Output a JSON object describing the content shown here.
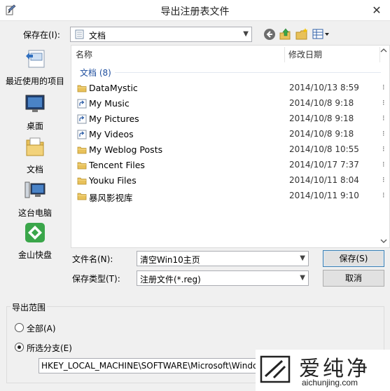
{
  "window": {
    "title": "导出注册表文件",
    "close_glyph": "✕"
  },
  "toolbar": {
    "save_in_label": "保存在(I):",
    "current_location": "文档"
  },
  "places": [
    {
      "label": "最近使用的项目",
      "icon": "recent-items-icon"
    },
    {
      "label": "桌面",
      "icon": "desktop-icon"
    },
    {
      "label": "文档",
      "icon": "documents-icon"
    },
    {
      "label": "这台电脑",
      "icon": "this-pc-icon"
    },
    {
      "label": "金山快盘",
      "icon": "kuaipan-icon"
    }
  ],
  "file_list": {
    "columns": [
      "名称",
      "修改日期"
    ],
    "group_label": "文档 (8)",
    "rows": [
      {
        "name": "DataMystic",
        "date": "2014/10/13 8:59",
        "type": "folder"
      },
      {
        "name": "My Music",
        "date": "2014/10/8 9:18",
        "type": "shortcut"
      },
      {
        "name": "My Pictures",
        "date": "2014/10/8 9:18",
        "type": "shortcut"
      },
      {
        "name": "My Videos",
        "date": "2014/10/8 9:18",
        "type": "shortcut"
      },
      {
        "name": "My Weblog Posts",
        "date": "2014/10/8 10:55",
        "type": "folder"
      },
      {
        "name": "Tencent Files",
        "date": "2014/10/17 7:37",
        "type": "folder"
      },
      {
        "name": "Youku Files",
        "date": "2014/10/11 8:04",
        "type": "folder"
      },
      {
        "name": "暴风影视库",
        "date": "2014/10/11 9:10",
        "type": "folder"
      }
    ]
  },
  "form": {
    "filename_label": "文件名(N):",
    "filename_value": "清空Win10主页",
    "filetype_label": "保存类型(T):",
    "filetype_value": "注册文件(*.reg)",
    "save_button": "保存(S)",
    "cancel_button": "取消"
  },
  "export_range": {
    "title": "导出范围",
    "option_all": "全部(A)",
    "option_selected": "所选分支(E)",
    "selected_option": "selected",
    "branch_value": "HKEY_LOCAL_MACHINE\\SOFTWARE\\Microsoft\\Windows"
  },
  "watermark": {
    "brand_cn": "爱纯净",
    "url": "aichunjing.com"
  },
  "colors": {
    "folder": "#e8c15a",
    "group_text": "#1e4e9e",
    "accent": "#3c7fb1",
    "kuaipan_green": "#3aa64a"
  }
}
